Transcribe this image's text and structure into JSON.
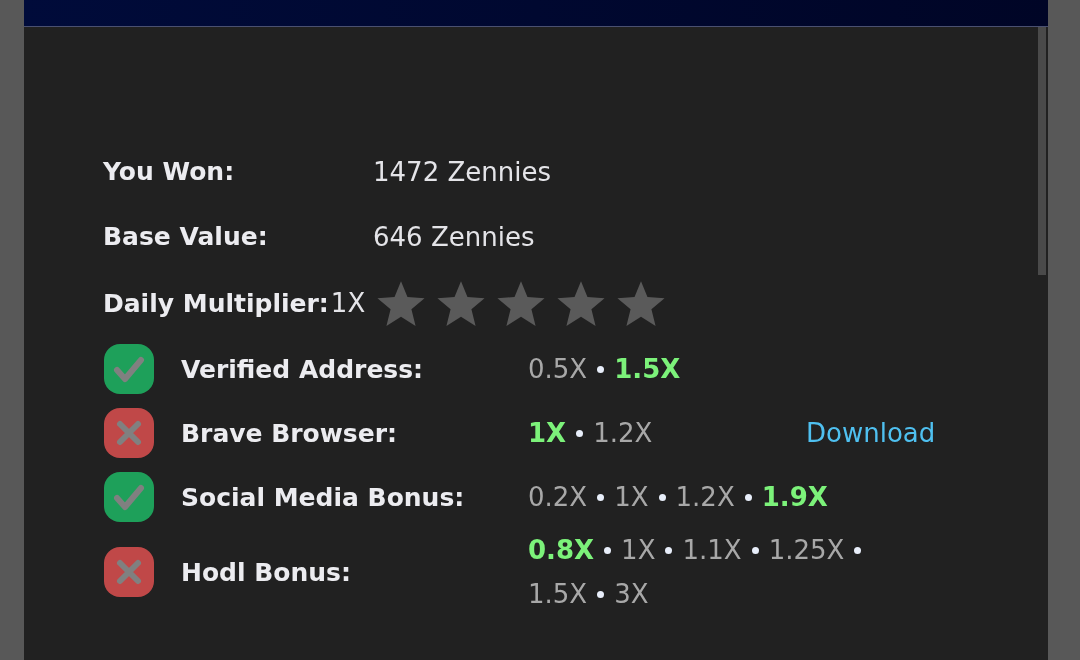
{
  "summary": [
    {
      "label": "You Won:",
      "value": "1472 Zennies"
    },
    {
      "label": "Base Value:",
      "value": "646 Zennies"
    }
  ],
  "daily": {
    "label": "Daily Multiplier:",
    "value": "1X",
    "stars": 0
  },
  "bonuses": [
    {
      "label": "Verified Address:",
      "done": true,
      "tiers": [
        {
          "text": "0.5X",
          "selected": false
        },
        {
          "text": "1.5X",
          "selected": true
        }
      ]
    },
    {
      "label": "Brave Browser:",
      "done": false,
      "tiers": [
        {
          "text": "1X",
          "selected": true
        },
        {
          "text": "1.2X",
          "selected": false
        }
      ],
      "link": "Download"
    },
    {
      "label": "Social Media Bonus:",
      "done": true,
      "tiers": [
        {
          "text": "0.2X",
          "selected": false
        },
        {
          "text": "1X",
          "selected": false
        },
        {
          "text": "1.2X",
          "selected": false
        },
        {
          "text": "1.9X",
          "selected": true
        }
      ]
    },
    {
      "label": "Hodl Bonus:",
      "done": false,
      "tiers": [
        {
          "text": "0.8X",
          "selected": true
        },
        {
          "text": "1X",
          "selected": false
        },
        {
          "text": "1.1X",
          "selected": false
        },
        {
          "text": "1.25X",
          "selected": false
        },
        {
          "text": "1.5X",
          "selected": false
        },
        {
          "text": "3X",
          "selected": false
        }
      ]
    }
  ]
}
